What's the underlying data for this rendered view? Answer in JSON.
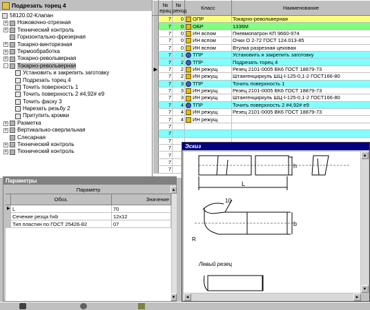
{
  "tree": {
    "header": "Подрезать торец 4",
    "root": "58120.02-Клапан",
    "operations": [
      {
        "label": "Ножовочно-отрезная",
        "exp": "+"
      },
      {
        "label": "Технический контроль",
        "exp": "+"
      },
      {
        "label": "Горизонтально-фрезерная",
        "exp": ""
      },
      {
        "label": "Токарно-винторезная",
        "exp": "+"
      },
      {
        "label": "Термообработка",
        "exp": "+"
      },
      {
        "label": "Токарно-револьверная",
        "exp": "+"
      },
      {
        "label": "Токарно-револьверная",
        "exp": "-",
        "selected": true
      }
    ],
    "transitions": [
      "Установить и закрепить заготовку",
      "Подрезать торец 4",
      "Точить поверхность 1",
      "Точить поверхность 2 #4,92# е9",
      "Точить фаску 3",
      "Нарезать резьбу 2",
      "Притупить кромки"
    ],
    "tail_operations": [
      {
        "label": "Разметка",
        "exp": "+"
      },
      {
        "label": "Вертикально-сверлильная",
        "exp": "+"
      },
      {
        "label": "Слесарная",
        "exp": ""
      },
      {
        "label": "Технический контроль",
        "exp": "+"
      },
      {
        "label": "Технический контроль",
        "exp": "+"
      }
    ]
  },
  "table": {
    "headers": [
      "№ ерац",
      "№ реход",
      "Класс",
      "Наименование"
    ],
    "rows": [
      {
        "a": "7",
        "b": "0",
        "cls": "ОПР",
        "name": "Токарно-револьверная",
        "color": "yellow",
        "icon": "y"
      },
      {
        "a": "7",
        "b": "0",
        "cls": "ОБР",
        "name": "1336М",
        "color": "green",
        "icon": "y"
      },
      {
        "a": "7",
        "b": "0",
        "cls": "ИН вспом",
        "name": "Пневмопатрон КП 9660-974",
        "color": "",
        "icon": "y"
      },
      {
        "a": "7",
        "b": "0",
        "cls": "ИН вспом",
        "name": "Очки О 2-72 ГОСТ 124.013-85",
        "color": "",
        "icon": "y"
      },
      {
        "a": "7",
        "b": "0",
        "cls": "ИН вспом",
        "name": "Втулка разрезная цековая",
        "color": "",
        "icon": "y"
      },
      {
        "a": "7",
        "b": "1",
        "cls": "ТПР",
        "name": "Установить и закрепить заготовку",
        "color": "cyan",
        "icon": "b"
      },
      {
        "a": "7",
        "b": "2",
        "cls": "ТПР",
        "name": "Подрезать торец 4",
        "color": "cyan",
        "icon": "b"
      },
      {
        "a": "7",
        "b": "2",
        "cls": "ИН режущ",
        "name": "Резец 2101-0005 ВК6 ГОСТ 18879-73",
        "color": "",
        "icon": "y",
        "pointer": true
      },
      {
        "a": "7",
        "b": "2",
        "cls": "ИН режущ",
        "name": "Штангенциркуль ШЦ-I-125-0,1-2 ГОСТ166-80",
        "color": "",
        "icon": "y"
      },
      {
        "a": "7",
        "b": "3",
        "cls": "ТПР",
        "name": "Точить поверхность 1",
        "color": "cyan",
        "icon": "b"
      },
      {
        "a": "7",
        "b": "3",
        "cls": "ИН режущ",
        "name": "Резец 2101-0005 ВК6 ГОСТ 18879-73",
        "color": "",
        "icon": "y"
      },
      {
        "a": "7",
        "b": "3",
        "cls": "ИН режущ",
        "name": "Штангенциркуль ШЦ-I-125-0,1-2 ГОСТ166-80",
        "color": "",
        "icon": "y"
      },
      {
        "a": "7",
        "b": "4",
        "cls": "ТПР",
        "name": "Точить поверхность 2 #4,92# е9",
        "color": "cyan",
        "icon": "b"
      },
      {
        "a": "7",
        "b": "4",
        "cls": "ИН режущ",
        "name": "Резец 2101-0005 ВК6 ГОСТ 18879-73",
        "color": "",
        "icon": "y"
      },
      {
        "a": "7",
        "b": "4",
        "cls": "ИН режущ",
        "name": "",
        "color": "",
        "icon": "y"
      },
      {
        "a": "7",
        "b": "",
        "cls": "",
        "name": "",
        "color": "",
        "icon": ""
      },
      {
        "a": "7",
        "b": "",
        "cls": "",
        "name": "",
        "color": "cyan",
        "icon": ""
      },
      {
        "a": "7",
        "b": "",
        "cls": "",
        "name": "",
        "color": "",
        "icon": ""
      },
      {
        "a": "7",
        "b": "",
        "cls": "",
        "name": "",
        "color": "",
        "icon": ""
      },
      {
        "a": "7",
        "b": "",
        "cls": "",
        "name": "",
        "color": "",
        "icon": ""
      },
      {
        "a": "7",
        "b": "",
        "cls": "",
        "name": "",
        "color": "",
        "icon": ""
      },
      {
        "a": "7",
        "b": "",
        "cls": "",
        "name": "",
        "color": "",
        "icon": ""
      }
    ]
  },
  "params": {
    "title": "Параметры",
    "group_header": "Параметр",
    "col1": "Обоз.",
    "col2": "Значение",
    "rows": [
      {
        "name": "L",
        "value": "70",
        "pointer": true
      },
      {
        "name": "Сечение резца hxb",
        "value": "12x12"
      },
      {
        "name": "Тип пластин по ГОСТ 25426-82",
        "value": "07"
      }
    ]
  },
  "sketch": {
    "title": "Эскиз",
    "labels": {
      "L": "L",
      "h": "h",
      "b": "b",
      "angle": "10",
      "radius": "R",
      "caption": "Левый резец"
    }
  }
}
